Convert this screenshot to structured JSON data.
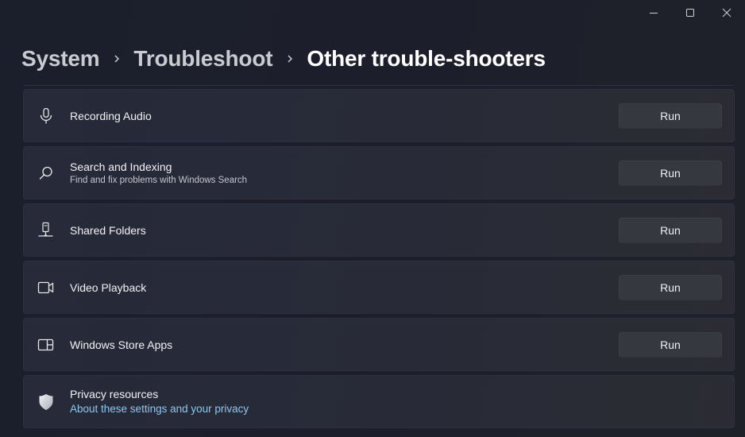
{
  "window": {
    "controls": [
      {
        "name": "minimize",
        "icon": "minimize-icon"
      },
      {
        "name": "maximize",
        "icon": "maximize-icon"
      },
      {
        "name": "close",
        "icon": "close-icon"
      }
    ]
  },
  "breadcrumb": {
    "items": [
      "System",
      "Troubleshoot",
      "Other trouble-shooters"
    ],
    "separator_icon": "chevron-right-icon"
  },
  "troubleshooters": [
    {
      "title": "Recording Audio",
      "subtitle": "",
      "icon": "microphone-icon",
      "button": "Run"
    },
    {
      "title": "Search and Indexing",
      "subtitle": "Find and fix problems with Windows Search",
      "icon": "search-icon",
      "button": "Run"
    },
    {
      "title": "Shared Folders",
      "subtitle": "",
      "icon": "shared-folder-icon",
      "button": "Run"
    },
    {
      "title": "Video Playback",
      "subtitle": "",
      "icon": "video-camera-icon",
      "button": "Run"
    },
    {
      "title": "Windows Store Apps",
      "subtitle": "",
      "icon": "store-apps-icon",
      "button": "Run"
    }
  ],
  "privacy": {
    "title": "Privacy resources",
    "link": "About these settings and your privacy",
    "icon": "shield-icon",
    "link_color": "#8cc8f0"
  }
}
